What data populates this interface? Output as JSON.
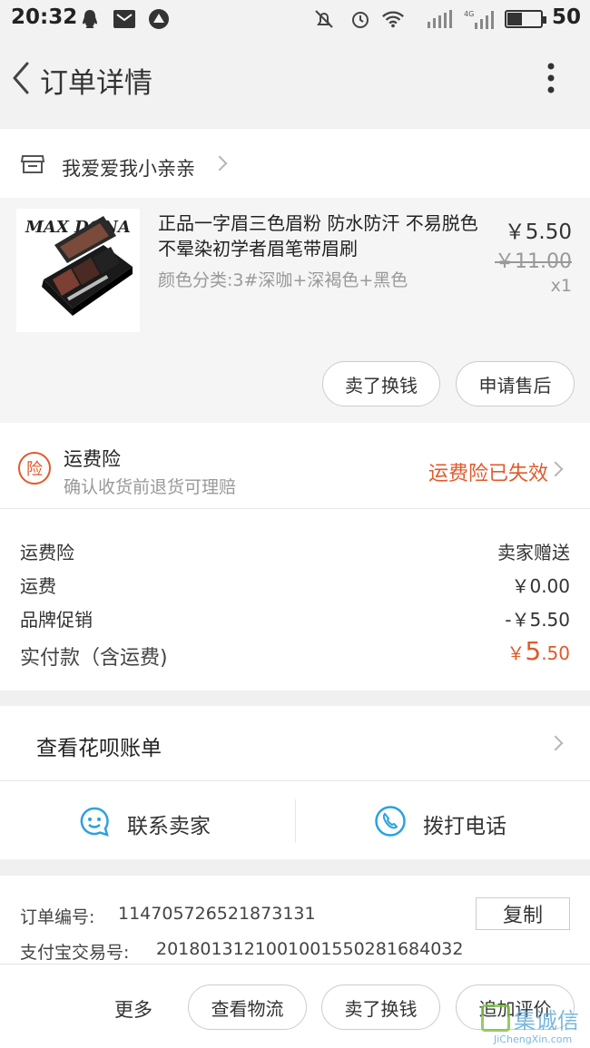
{
  "status_bar": {
    "time": "20:32",
    "battery": "50",
    "icons": [
      "qq-icon",
      "notification-icon",
      "browser-icon",
      "mute-icon",
      "alarm-icon",
      "wifi-icon",
      "signal-icon",
      "signal-4g-icon",
      "battery-icon"
    ]
  },
  "header": {
    "title": "订单详情"
  },
  "shop": {
    "name": "我爱爱我小亲亲"
  },
  "product": {
    "brand_logo": "MAX DONA",
    "title": "正品一字眉三色眉粉 防水防汗 不易脱色不晕染初学者眉笔带眉刷",
    "variant": "颜色分类:3#深咖+深褐色+黑色",
    "price": "￥5.50",
    "original_price": "￥11.00",
    "quantity": "x1",
    "actions": [
      "卖了换钱",
      "申请售后"
    ]
  },
  "insurance": {
    "badge": "险",
    "title": "运费险",
    "subtitle": "确认收货前退货可理赔",
    "status": "运费险已失效"
  },
  "summary": {
    "rows": [
      {
        "label": "运费险",
        "value": "卖家赠送"
      },
      {
        "label": "运费",
        "value": "￥0.00"
      },
      {
        "label": "品牌促销",
        "value": "-￥5.50"
      }
    ],
    "total_label": "实付款（含运费)",
    "total_currency": "￥",
    "total_int": "5",
    "total_dec": ".50"
  },
  "huabei": {
    "label": "查看花呗账单"
  },
  "contact": {
    "seller": "联系卖家",
    "phone": "拨打电话"
  },
  "order_info": {
    "order_no_label": "订单编号:",
    "order_no": "114705726521873131",
    "copy_label": "复制",
    "alipay_label": "支付宝交易号:",
    "alipay_no": "2018013121001001550281684032"
  },
  "bottom_bar": {
    "more": "更多",
    "buttons": [
      "查看物流",
      "卖了换钱",
      "追加评价"
    ]
  },
  "watermark": {
    "brand": "集诚信",
    "url": "JiChengXin.com"
  },
  "colors": {
    "accent": "#e2592a",
    "blue": "#2aa2e0",
    "text": "#222222",
    "muted": "#999999"
  }
}
